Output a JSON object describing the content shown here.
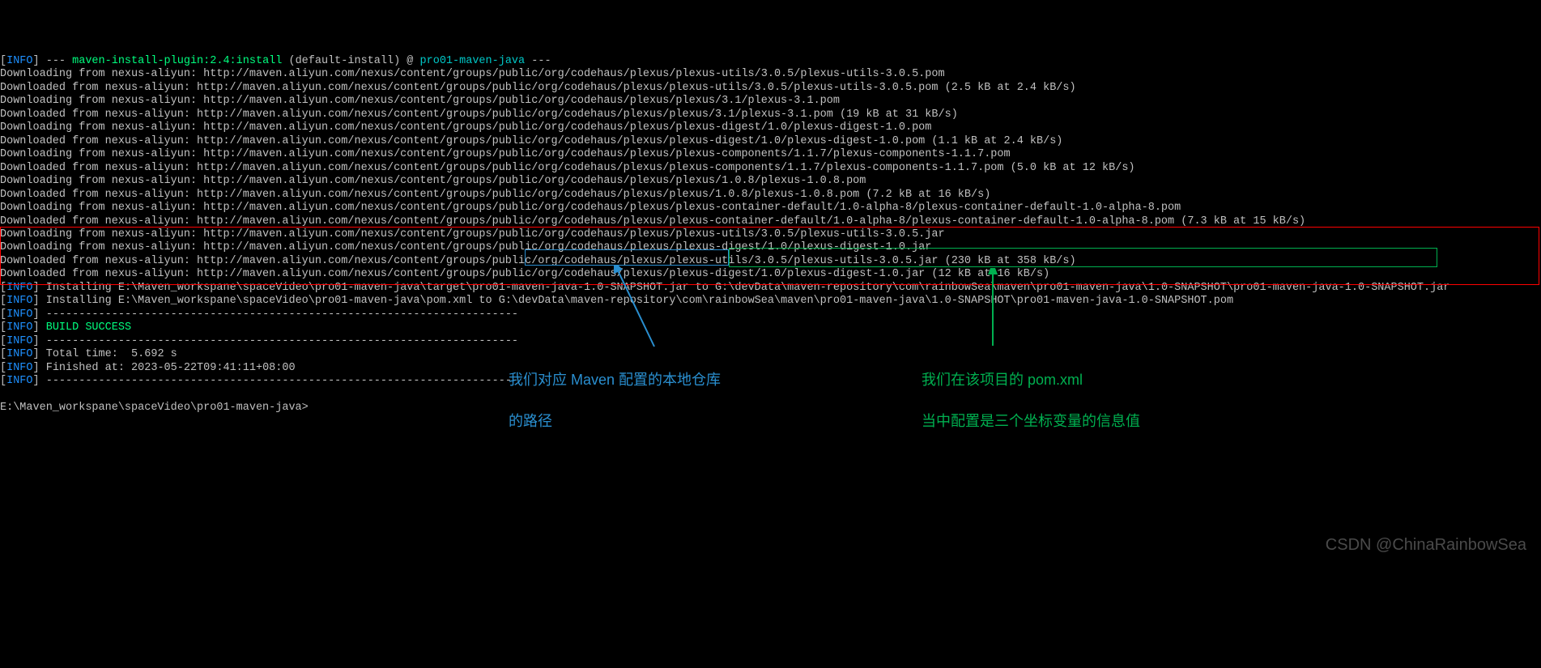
{
  "header": {
    "line1_prefix": "INFO",
    "line1_mid": "] --- ",
    "line1_plugin": "maven-install-plugin:2.4:install",
    "line1_default": " (default-install) @ ",
    "line1_project": "pro01-maven-java",
    "line1_end": " ---"
  },
  "logs": [
    "Downloading from nexus-aliyun: http://maven.aliyun.com/nexus/content/groups/public/org/codehaus/plexus/plexus-utils/3.0.5/plexus-utils-3.0.5.pom",
    "Downloaded from nexus-aliyun: http://maven.aliyun.com/nexus/content/groups/public/org/codehaus/plexus/plexus-utils/3.0.5/plexus-utils-3.0.5.pom (2.5 kB at 2.4 kB/s)",
    "Downloading from nexus-aliyun: http://maven.aliyun.com/nexus/content/groups/public/org/codehaus/plexus/plexus/3.1/plexus-3.1.pom",
    "Downloaded from nexus-aliyun: http://maven.aliyun.com/nexus/content/groups/public/org/codehaus/plexus/plexus/3.1/plexus-3.1.pom (19 kB at 31 kB/s)",
    "Downloading from nexus-aliyun: http://maven.aliyun.com/nexus/content/groups/public/org/codehaus/plexus/plexus-digest/1.0/plexus-digest-1.0.pom",
    "Downloaded from nexus-aliyun: http://maven.aliyun.com/nexus/content/groups/public/org/codehaus/plexus/plexus-digest/1.0/plexus-digest-1.0.pom (1.1 kB at 2.4 kB/s)",
    "Downloading from nexus-aliyun: http://maven.aliyun.com/nexus/content/groups/public/org/codehaus/plexus/plexus-components/1.1.7/plexus-components-1.1.7.pom",
    "Downloaded from nexus-aliyun: http://maven.aliyun.com/nexus/content/groups/public/org/codehaus/plexus/plexus-components/1.1.7/plexus-components-1.1.7.pom (5.0 kB at 12 kB/s)",
    "Downloading from nexus-aliyun: http://maven.aliyun.com/nexus/content/groups/public/org/codehaus/plexus/plexus/1.0.8/plexus-1.0.8.pom",
    "Downloaded from nexus-aliyun: http://maven.aliyun.com/nexus/content/groups/public/org/codehaus/plexus/plexus/1.0.8/plexus-1.0.8.pom (7.2 kB at 16 kB/s)",
    "Downloading from nexus-aliyun: http://maven.aliyun.com/nexus/content/groups/public/org/codehaus/plexus/plexus-container-default/1.0-alpha-8/plexus-container-default-1.0-alpha-8.pom",
    "Downloaded from nexus-aliyun: http://maven.aliyun.com/nexus/content/groups/public/org/codehaus/plexus/plexus-container-default/1.0-alpha-8/plexus-container-default-1.0-alpha-8.pom (7.3 kB at 15 kB/s)",
    "Downloading from nexus-aliyun: http://maven.aliyun.com/nexus/content/groups/public/org/codehaus/plexus/plexus-utils/3.0.5/plexus-utils-3.0.5.jar",
    "Downloading from nexus-aliyun: http://maven.aliyun.com/nexus/content/groups/public/org/codehaus/plexus/plexus-digest/1.0/plexus-digest-1.0.jar",
    "Downloaded from nexus-aliyun: http://maven.aliyun.com/nexus/content/groups/public/org/codehaus/plexus/plexus-utils/3.0.5/plexus-utils-3.0.5.jar (230 kB at 358 kB/s)",
    "Downloaded from nexus-aliyun: http://maven.aliyun.com/nexus/content/groups/public/org/codehaus/plexus/plexus-digest/1.0/plexus-digest-1.0.jar (12 kB at 16 kB/s)"
  ],
  "info_install1": " Installing E:\\Maven_workspane\\spaceVideo\\pro01-maven-java\\target\\pro01-maven-java-1.0-SNAPSHOT.jar to G:\\devData\\maven-repository\\com\\rainbowSea\\maven\\pro01-maven-java\\1.0-SNAPSHOT\\pro01-maven-java-1.0-SNAPSHOT.jar",
  "info_install2": " Installing E:\\Maven_workspane\\spaceVideo\\pro01-maven-java\\pom.xml to G:\\devData\\maven-repository\\com\\rainbowSea\\maven\\pro01-maven-java\\1.0-SNAPSHOT\\pro01-maven-java-1.0-SNAPSHOT.pom",
  "sep": " ------------------------------------------------------------------------",
  "build_success": " BUILD SUCCESS",
  "total_time": " Total time:  5.692 s",
  "finished_at": " Finished at: 2023-05-22T09:41:11+08:00",
  "prompt": "E:\\Maven_workspane\\spaceVideo\\pro01-maven-java>",
  "annot_blue_l1": "我们对应 Maven 配置的本地仓库",
  "annot_blue_l2": "的路径",
  "annot_green_l1": "我们在该项目的 pom.xml",
  "annot_green_l2": "当中配置是三个坐标变量的信息值",
  "watermark": "CSDN @ChinaRainbowSea",
  "info_label": "INFO"
}
